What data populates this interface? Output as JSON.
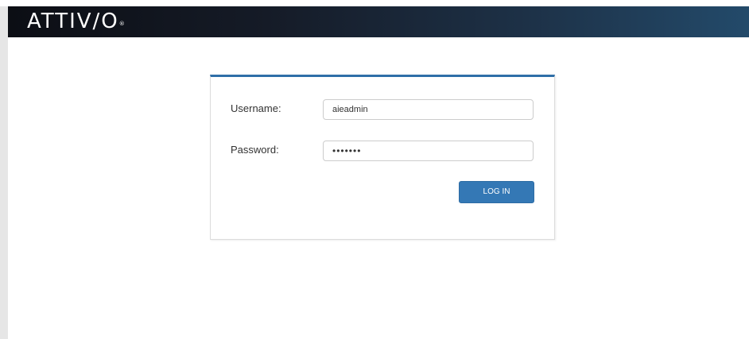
{
  "brand": {
    "logo_text": "ATTIV/O",
    "registered_mark": "®"
  },
  "login": {
    "username_label": "Username:",
    "username_value": "aieadmin",
    "password_label": "Password:",
    "password_value": "•••••••",
    "submit_label": "LOG IN"
  },
  "colors": {
    "header_start": "#0c0e14",
    "header_end": "#234a6a",
    "panel_accent": "#2f6fa8",
    "button": "#3478b5"
  }
}
